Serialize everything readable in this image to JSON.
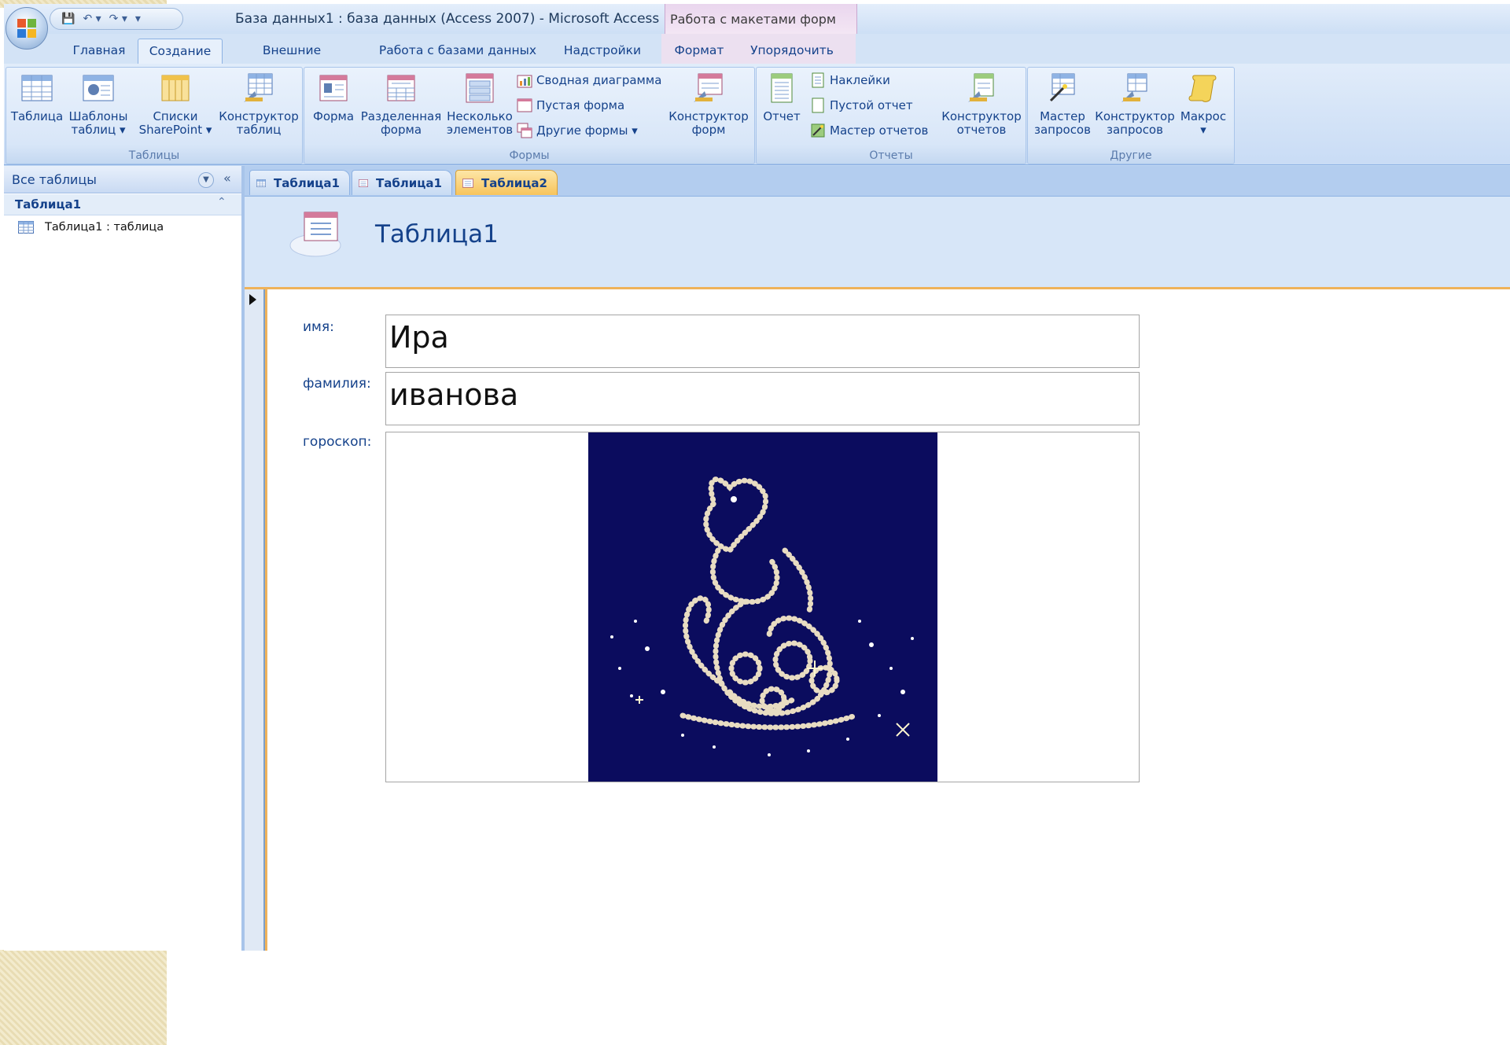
{
  "window": {
    "title": "База данных1 : база данных (Access 2007) - Microsoft Access",
    "context_tab_group": "Работа с макетами форм"
  },
  "quick_access": {
    "save": "💾",
    "undo": "↶ ▾",
    "redo": "↷ ▾",
    "customize": "▾"
  },
  "ribbon_tabs": [
    "Главная",
    "Создание",
    "Внешние данные",
    "Работа с базами данных",
    "Надстройки",
    "Формат",
    "Упорядочить"
  ],
  "active_tab": "Создание",
  "ribbon": {
    "groups": {
      "tables": "Таблицы",
      "forms": "Формы",
      "reports": "Отчеты",
      "other": "Другие"
    },
    "tables": {
      "table": "Таблица",
      "templates_1": "Шаблоны",
      "templates_2": "таблиц ▾",
      "sharepoint_1": "Списки",
      "sharepoint_2": "SharePoint ▾",
      "designer_1": "Конструктор",
      "designer_2": "таблиц"
    },
    "forms": {
      "form": "Форма",
      "split_1": "Разделенная",
      "split_2": "форма",
      "multi_1": "Несколько",
      "multi_2": "элементов",
      "pivot_chart": "Сводная диаграмма",
      "blank_form": "Пустая форма",
      "more_forms": "Другие формы ▾",
      "designer_1": "Конструктор",
      "designer_2": "форм"
    },
    "reports": {
      "report": "Отчет",
      "labels": "Наклейки",
      "blank_report": "Пустой отчет",
      "wizard": "Мастер отчетов",
      "designer_1": "Конструктор",
      "designer_2": "отчетов"
    },
    "other": {
      "query_wizard_1": "Мастер",
      "query_wizard_2": "запросов",
      "query_designer_1": "Конструктор",
      "query_designer_2": "запросов",
      "macro": "Макрос",
      "macro_drop": "▾"
    }
  },
  "nav": {
    "header": "Все таблицы",
    "group": "Таблица1",
    "items": [
      "Таблица1 : таблица"
    ]
  },
  "doc_tabs": [
    "Таблица1",
    "Таблица1",
    "Таблица2"
  ],
  "form": {
    "header_title": "Таблица1",
    "fields": [
      {
        "label": "имя:",
        "value": "Ира"
      },
      {
        "label": "фамилия:",
        "value": "иванова"
      },
      {
        "label": "гороскоп:",
        "value": ""
      }
    ]
  }
}
